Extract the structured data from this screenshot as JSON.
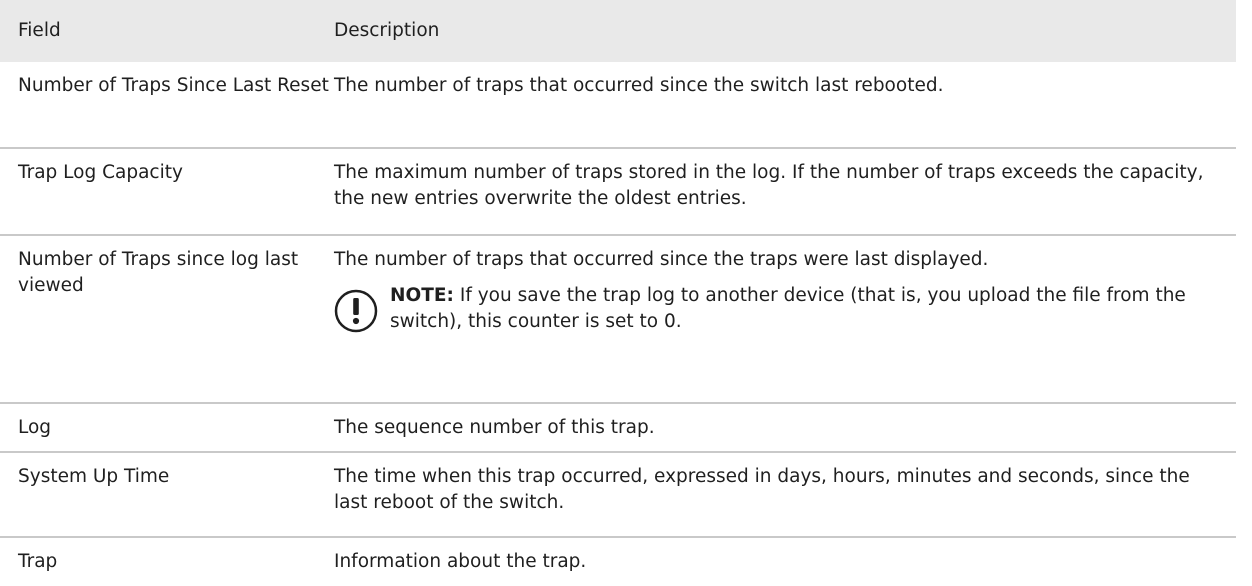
{
  "table": {
    "header": {
      "field": "Field",
      "description": "Description"
    },
    "rows": [
      {
        "field": "Number of Traps Since Last Reset",
        "description": "The number of traps that occurred since the switch last rebooted."
      },
      {
        "field": "Trap Log Capacity",
        "description": "The maximum number of traps stored in the log. If the number of traps exceeds the capacity, the new entries overwrite the oldest entries."
      },
      {
        "field": "Number of Traps since log last viewed",
        "description": "The number of traps that occurred since the traps were last displayed.",
        "note_label": "NOTE:",
        "note_text": "If you save the trap log to another device (that is, you upload the file from the switch), this counter is set to 0.",
        "note_icon": "exclamation-circle-icon"
      },
      {
        "field": "Log",
        "description": "The sequence number of this trap."
      },
      {
        "field": "System Up Time",
        "description": "The time when this trap occurred, expressed in days, hours, minutes and seconds, since the last reboot of the switch."
      },
      {
        "field": "Trap",
        "description": "Information about the trap."
      }
    ]
  },
  "colors": {
    "header_background": "#e9e9e9",
    "row_divider": "#c9c9c9",
    "text": "#1f1f1f"
  }
}
